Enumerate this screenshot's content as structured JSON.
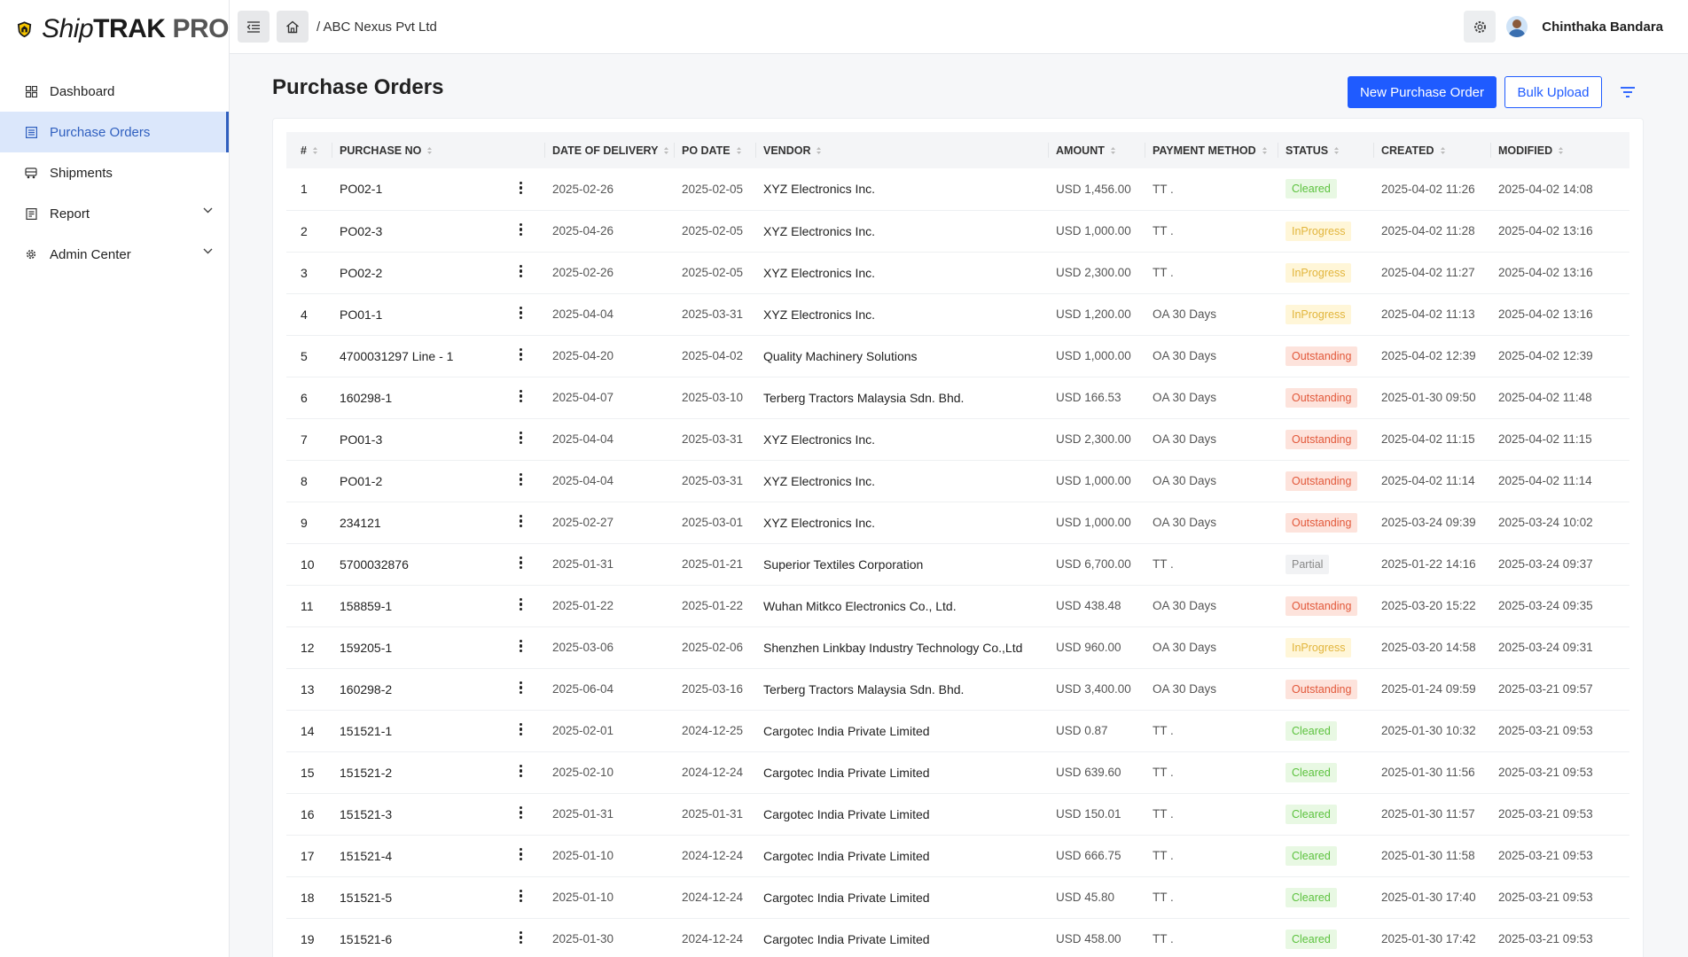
{
  "app": {
    "logo_ship": "Ship",
    "logo_trak": "TRAK",
    "logo_pro": "PRO",
    "brand_color": "#f7c600"
  },
  "sidebar": {
    "items": [
      {
        "label": "Dashboard",
        "icon": "dashboard-icon"
      },
      {
        "label": "Purchase Orders",
        "icon": "list-icon",
        "active": true
      },
      {
        "label": "Shipments",
        "icon": "truck-icon"
      },
      {
        "label": "Report",
        "icon": "report-icon",
        "expandable": true
      },
      {
        "label": "Admin Center",
        "icon": "gear-icon",
        "expandable": true
      }
    ]
  },
  "topbar": {
    "breadcrumb": "/ ABC Nexus Pvt Ltd",
    "user_name": "Chinthaka Bandara"
  },
  "page": {
    "title": "Purchase Orders",
    "new_button": "New Purchase Order",
    "bulk_button": "Bulk Upload"
  },
  "table": {
    "headers": {
      "num": "#",
      "purchase_no": "PURCHASE NO",
      "delivery": "DATE OF DELIVERY",
      "po_date": "PO DATE",
      "vendor": "VENDOR",
      "amount": "AMOUNT",
      "payment": "PAYMENT METHOD",
      "status": "STATUS",
      "created": "CREATED",
      "modified": "MODIFIED"
    },
    "rows": [
      {
        "num": "1",
        "pno": "PO02-1",
        "delivery": "2025-02-26",
        "po_date": "2025-02-05",
        "vendor": "XYZ Electronics Inc.",
        "amount": "USD 1,456.00",
        "payment": "TT .",
        "status": "Cleared",
        "created": "2025-04-02 11:26",
        "modified": "2025-04-02 14:08"
      },
      {
        "num": "2",
        "pno": "PO02-3",
        "delivery": "2025-04-26",
        "po_date": "2025-02-05",
        "vendor": "XYZ Electronics Inc.",
        "amount": "USD 1,000.00",
        "payment": "TT .",
        "status": "InProgress",
        "created": "2025-04-02 11:28",
        "modified": "2025-04-02 13:16"
      },
      {
        "num": "3",
        "pno": "PO02-2",
        "delivery": "2025-02-26",
        "po_date": "2025-02-05",
        "vendor": "XYZ Electronics Inc.",
        "amount": "USD 2,300.00",
        "payment": "TT .",
        "status": "InProgress",
        "created": "2025-04-02 11:27",
        "modified": "2025-04-02 13:16"
      },
      {
        "num": "4",
        "pno": "PO01-1",
        "delivery": "2025-04-04",
        "po_date": "2025-03-31",
        "vendor": "XYZ Electronics Inc.",
        "amount": "USD 1,200.00",
        "payment": "OA 30 Days",
        "status": "InProgress",
        "created": "2025-04-02 11:13",
        "modified": "2025-04-02 13:16"
      },
      {
        "num": "5",
        "pno": "4700031297 Line - 1",
        "delivery": "2025-04-20",
        "po_date": "2025-04-02",
        "vendor": "Quality Machinery Solutions",
        "amount": "USD 1,000.00",
        "payment": "OA 30 Days",
        "status": "Outstanding",
        "created": "2025-04-02 12:39",
        "modified": "2025-04-02 12:39"
      },
      {
        "num": "6",
        "pno": "160298-1",
        "delivery": "2025-04-07",
        "po_date": "2025-03-10",
        "vendor": "Terberg Tractors Malaysia Sdn. Bhd.",
        "amount": "USD 166.53",
        "payment": "OA 30 Days",
        "status": "Outstanding",
        "created": "2025-01-30 09:50",
        "modified": "2025-04-02 11:48"
      },
      {
        "num": "7",
        "pno": "PO01-3",
        "delivery": "2025-04-04",
        "po_date": "2025-03-31",
        "vendor": "XYZ Electronics Inc.",
        "amount": "USD 2,300.00",
        "payment": "OA 30 Days",
        "status": "Outstanding",
        "created": "2025-04-02 11:15",
        "modified": "2025-04-02 11:15"
      },
      {
        "num": "8",
        "pno": "PO01-2",
        "delivery": "2025-04-04",
        "po_date": "2025-03-31",
        "vendor": "XYZ Electronics Inc.",
        "amount": "USD 1,000.00",
        "payment": "OA 30 Days",
        "status": "Outstanding",
        "created": "2025-04-02 11:14",
        "modified": "2025-04-02 11:14"
      },
      {
        "num": "9",
        "pno": "234121",
        "delivery": "2025-02-27",
        "po_date": "2025-03-01",
        "vendor": "XYZ Electronics Inc.",
        "amount": "USD 1,000.00",
        "payment": "OA 30 Days",
        "status": "Outstanding",
        "created": "2025-03-24 09:39",
        "modified": "2025-03-24 10:02"
      },
      {
        "num": "10",
        "pno": "5700032876",
        "delivery": "2025-01-31",
        "po_date": "2025-01-21",
        "vendor": "Superior Textiles Corporation",
        "amount": "USD 6,700.00",
        "payment": "TT .",
        "status": "Partial",
        "created": "2025-01-22 14:16",
        "modified": "2025-03-24 09:37"
      },
      {
        "num": "11",
        "pno": "158859-1",
        "delivery": "2025-01-22",
        "po_date": "2025-01-22",
        "vendor": "Wuhan Mitkco Electronics Co., Ltd.",
        "amount": "USD 438.48",
        "payment": "OA 30 Days",
        "status": "Outstanding",
        "created": "2025-03-20 15:22",
        "modified": "2025-03-24 09:35"
      },
      {
        "num": "12",
        "pno": "159205-1",
        "delivery": "2025-03-06",
        "po_date": "2025-02-06",
        "vendor": "Shenzhen Linkbay Industry Technology Co.,Ltd",
        "amount": "USD 960.00",
        "payment": "OA 30 Days",
        "status": "InProgress",
        "created": "2025-03-20 14:58",
        "modified": "2025-03-24 09:31"
      },
      {
        "num": "13",
        "pno": "160298-2",
        "delivery": "2025-06-04",
        "po_date": "2025-03-16",
        "vendor": "Terberg Tractors Malaysia Sdn. Bhd.",
        "amount": "USD 3,400.00",
        "payment": "OA 30 Days",
        "status": "Outstanding",
        "created": "2025-01-24 09:59",
        "modified": "2025-03-21 09:57"
      },
      {
        "num": "14",
        "pno": "151521-1",
        "delivery": "2025-02-01",
        "po_date": "2024-12-25",
        "vendor": "Cargotec India Private Limited",
        "amount": "USD 0.87",
        "payment": "TT .",
        "status": "Cleared",
        "created": "2025-01-30 10:32",
        "modified": "2025-03-21 09:53"
      },
      {
        "num": "15",
        "pno": "151521-2",
        "delivery": "2025-02-10",
        "po_date": "2024-12-24",
        "vendor": "Cargotec India Private Limited",
        "amount": "USD 639.60",
        "payment": "TT .",
        "status": "Cleared",
        "created": "2025-01-30 11:56",
        "modified": "2025-03-21 09:53"
      },
      {
        "num": "16",
        "pno": "151521-3",
        "delivery": "2025-01-31",
        "po_date": "2025-01-31",
        "vendor": "Cargotec India Private Limited",
        "amount": "USD 150.01",
        "payment": "TT .",
        "status": "Cleared",
        "created": "2025-01-30 11:57",
        "modified": "2025-03-21 09:53"
      },
      {
        "num": "17",
        "pno": "151521-4",
        "delivery": "2025-01-10",
        "po_date": "2024-12-24",
        "vendor": "Cargotec India Private Limited",
        "amount": "USD 666.75",
        "payment": "TT .",
        "status": "Cleared",
        "created": "2025-01-30 11:58",
        "modified": "2025-03-21 09:53"
      },
      {
        "num": "18",
        "pno": "151521-5",
        "delivery": "2025-01-10",
        "po_date": "2024-12-24",
        "vendor": "Cargotec India Private Limited",
        "amount": "USD 45.80",
        "payment": "TT .",
        "status": "Cleared",
        "created": "2025-01-30 17:40",
        "modified": "2025-03-21 09:53"
      },
      {
        "num": "19",
        "pno": "151521-6",
        "delivery": "2025-01-30",
        "po_date": "2024-12-24",
        "vendor": "Cargotec India Private Limited",
        "amount": "USD 458.00",
        "payment": "TT .",
        "status": "Cleared",
        "created": "2025-01-30 17:42",
        "modified": "2025-03-21 09:53"
      }
    ]
  }
}
